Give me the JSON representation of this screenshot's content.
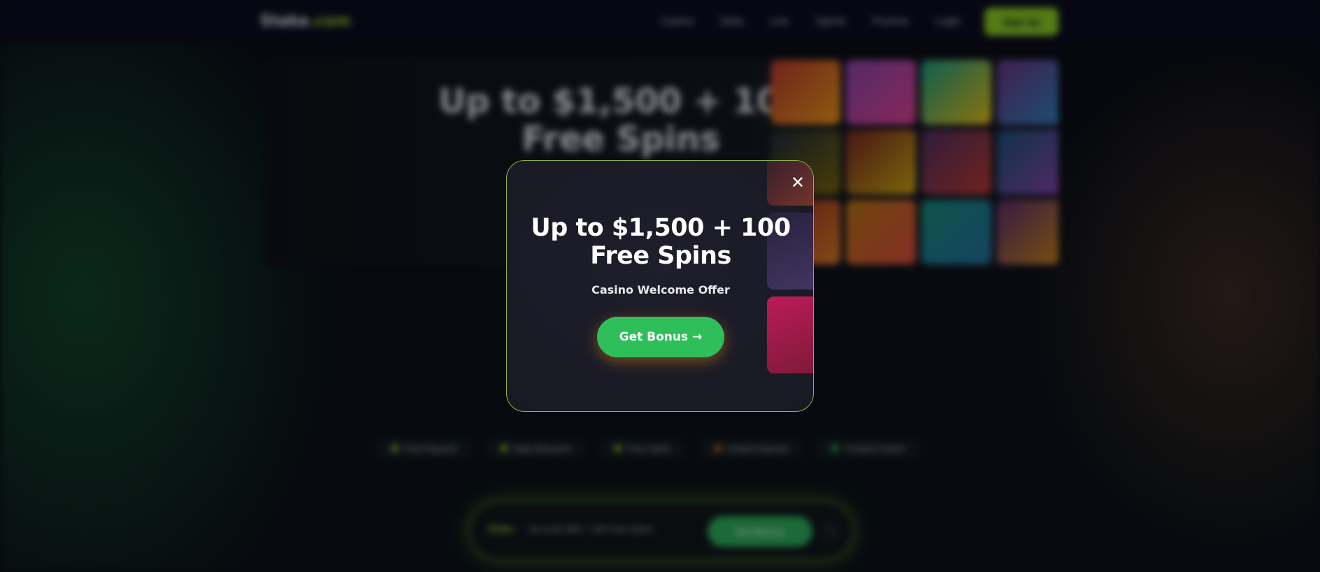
{
  "background": {
    "nav": {
      "logo_main": "Stake",
      "logo_accent": ".com",
      "items": [
        "Casino",
        "Slots",
        "Live",
        "Sports",
        "Promos",
        "Login"
      ],
      "cta_label": "Sign Up"
    },
    "hero": {
      "title": "Up to $1,500 + 100 Free Spins"
    },
    "features": [
      "Fast Payouts",
      "Daily Bonuses",
      "Free Spins",
      "Instant Deposit",
      "Trusted Casino"
    ],
    "sticky_bar": {
      "brand": "Stake",
      "offer": "Up to $1,500 + 100 Free Spins",
      "cta_label": "Get Bonus",
      "close_glyph": "×"
    }
  },
  "modal": {
    "close_glyph": "✕",
    "title_line1": "Up to $1,500 + 100",
    "title_line2": "Free Spins",
    "subtitle": "Casino Welcome Offer",
    "cta_label": "Get Bonus",
    "cta_arrow": "→"
  },
  "colors": {
    "accent_green": "#2fbf5a",
    "border_lime": "#8fb23a",
    "nav_cta_lime": "#8fd11f",
    "modal_bg": "#1a1a24"
  }
}
